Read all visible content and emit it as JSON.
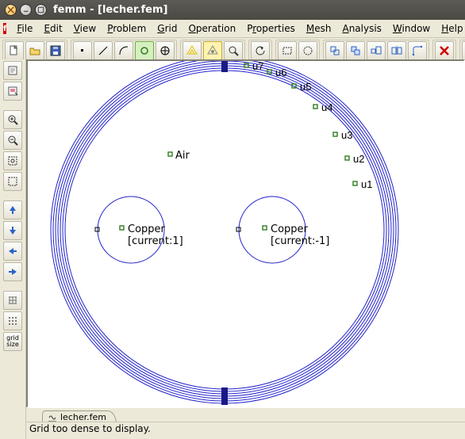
{
  "window": {
    "title": "femm - [lecher.fem]"
  },
  "menubar": {
    "file": "File",
    "edit": "Edit",
    "view": "View",
    "problem": "Problem",
    "grid": "Grid",
    "operation": "Operation",
    "properties": "Properties",
    "mesh": "Mesh",
    "analysis": "Analysis",
    "window": "Window",
    "help": "Help"
  },
  "side": {
    "grid_size_label": "grid\nsize"
  },
  "canvas": {
    "air_label": "Air",
    "copper1_label": "Copper",
    "copper1_sub": "[current:1]",
    "copper2_label": "Copper",
    "copper2_sub": "[current:-1]",
    "u_labels": [
      "u7",
      "u6",
      "u5",
      "u4",
      "u3",
      "u2",
      "u1"
    ]
  },
  "tab": {
    "name": "lecher.fem"
  },
  "status": {
    "text": "Grid too dense to display."
  },
  "colors": {
    "circle": "#2222cc",
    "marker": "#2f7d1e"
  }
}
